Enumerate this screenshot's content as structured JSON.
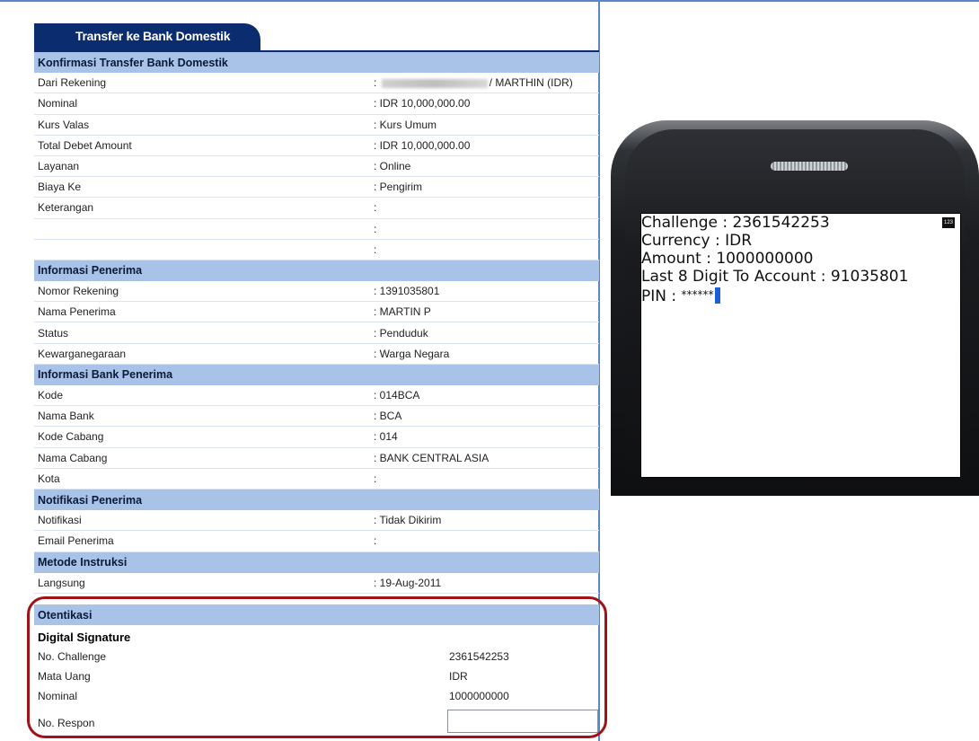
{
  "tab_title": "Transfer ke Bank Domestik",
  "sections": {
    "konfirmasi": {
      "title": "Konfirmasi Transfer Bank Domestik",
      "rows": [
        {
          "label": "Dari Rekening",
          "value": "/ MARTHIN (IDR)"
        },
        {
          "label": "Nominal",
          "value": ": IDR  10,000,000.00"
        },
        {
          "label": "Kurs Valas",
          "value": ": Kurs Umum"
        },
        {
          "label": "Total Debet Amount",
          "value": ":  IDR 10,000,000.00"
        },
        {
          "label": "Layanan",
          "value": ": Online"
        },
        {
          "label": "Biaya Ke",
          "value": ": Pengirim"
        },
        {
          "label": "Keterangan",
          "value": ":"
        },
        {
          "label": "",
          "value": ":"
        },
        {
          "label": "",
          "value": ":"
        }
      ]
    },
    "penerima": {
      "title": "Informasi Penerima",
      "rows": [
        {
          "label": "Nomor Rekening",
          "value": ": 1391035801"
        },
        {
          "label": "Nama Penerima",
          "value": ": MARTIN P"
        },
        {
          "label": "Status",
          "value": ": Penduduk"
        },
        {
          "label": "Kewarganegaraan",
          "value": ": Warga Negara"
        }
      ]
    },
    "bank": {
      "title": "Informasi Bank Penerima",
      "rows": [
        {
          "label": "Kode",
          "value": ": 014BCA"
        },
        {
          "label": "Nama Bank",
          "value": ": BCA"
        },
        {
          "label": "Kode Cabang",
          "value": ": 014"
        },
        {
          "label": "Nama Cabang",
          "value": ": BANK CENTRAL ASIA"
        },
        {
          "label": "Kota",
          "value": ":"
        }
      ]
    },
    "notifikasi": {
      "title": "Notifikasi Penerima",
      "rows": [
        {
          "label": "Notifikasi",
          "value": ": Tidak Dikirim"
        },
        {
          "label": "Email Penerima",
          "value": ":"
        }
      ]
    },
    "metode": {
      "title": "Metode Instruksi",
      "rows": [
        {
          "label": "Langsung",
          "value": ": 19-Aug-2011"
        }
      ]
    }
  },
  "otentikasi": {
    "title": "Otentikasi",
    "subtitle": "Digital Signature",
    "challenge_label": "No. Challenge",
    "challenge_value": "2361542253",
    "currency_label": "Mata Uang",
    "currency_value": "IDR",
    "nominal_label": "Nominal",
    "nominal_value": "1000000000",
    "respon_label": "No. Respon",
    "respon_value": ""
  },
  "phone_screen": {
    "line1": "Challenge :  2361542253",
    "line2": "Currency :  IDR",
    "line3": "Amount :  1000000000",
    "line4": "Last 8 Digit To Account :  91035801",
    "pin_label": "PIN :  ",
    "pin_value": "******",
    "mode_badge": "123"
  },
  "colors": {
    "tab_bg": "#0b2c6f",
    "section_bg": "#a8c2e8",
    "highlight_ring": "#a01216",
    "frame_border": "#5b87c7"
  }
}
